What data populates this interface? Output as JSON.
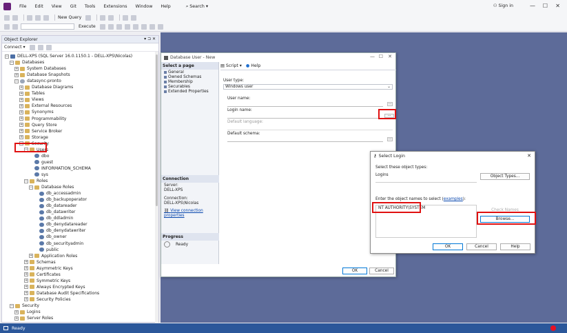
{
  "menubar": {
    "items": [
      "File",
      "Edit",
      "View",
      "Git",
      "Tools",
      "Extensions",
      "Window",
      "Help"
    ],
    "search": "Search",
    "signin": "Sign in"
  },
  "toolbar": {
    "new_query": "New Query",
    "execute": "Execute"
  },
  "object_explorer": {
    "title": "Object Explorer",
    "connect": "Connect",
    "tree": [
      {
        "label": "DELL-XPS (SQL Server 16.0.1150.1 - DELL-XPS\\Nicolas)",
        "indent": 0,
        "toggle": "−",
        "icon": "server"
      },
      {
        "label": "Databases",
        "indent": 1,
        "toggle": "−",
        "icon": "folder"
      },
      {
        "label": "System Databases",
        "indent": 2,
        "toggle": "+",
        "icon": "folder"
      },
      {
        "label": "Database Snapshots",
        "indent": 2,
        "toggle": "+",
        "icon": "folder"
      },
      {
        "label": "datasync-pronto",
        "indent": 2,
        "toggle": "−",
        "icon": "db"
      },
      {
        "label": "Database Diagrams",
        "indent": 3,
        "toggle": "+",
        "icon": "folder"
      },
      {
        "label": "Tables",
        "indent": 3,
        "toggle": "+",
        "icon": "folder"
      },
      {
        "label": "Views",
        "indent": 3,
        "toggle": "+",
        "icon": "folder"
      },
      {
        "label": "External Resources",
        "indent": 3,
        "toggle": "+",
        "icon": "folder"
      },
      {
        "label": "Synonyms",
        "indent": 3,
        "toggle": "+",
        "icon": "folder"
      },
      {
        "label": "Programmability",
        "indent": 3,
        "toggle": "+",
        "icon": "folder"
      },
      {
        "label": "Query Store",
        "indent": 3,
        "toggle": "+",
        "icon": "folder"
      },
      {
        "label": "Service Broker",
        "indent": 3,
        "toggle": "+",
        "icon": "folder"
      },
      {
        "label": "Storage",
        "indent": 3,
        "toggle": "+",
        "icon": "folder"
      },
      {
        "label": "Security",
        "indent": 3,
        "toggle": "−",
        "icon": "folder"
      },
      {
        "label": "Users",
        "indent": 4,
        "toggle": "−",
        "icon": "folder"
      },
      {
        "label": "dbo",
        "indent": 5,
        "toggle": "",
        "icon": "user"
      },
      {
        "label": "guest",
        "indent": 5,
        "toggle": "",
        "icon": "user"
      },
      {
        "label": "INFORMATION_SCHEMA",
        "indent": 5,
        "toggle": "",
        "icon": "user"
      },
      {
        "label": "sys",
        "indent": 5,
        "toggle": "",
        "icon": "user"
      },
      {
        "label": "Roles",
        "indent": 4,
        "toggle": "−",
        "icon": "folder"
      },
      {
        "label": "Database Roles",
        "indent": 5,
        "toggle": "−",
        "icon": "folder"
      },
      {
        "label": "db_accessadmin",
        "indent": 6,
        "toggle": "",
        "icon": "user"
      },
      {
        "label": "db_backupoperator",
        "indent": 6,
        "toggle": "",
        "icon": "user"
      },
      {
        "label": "db_datareader",
        "indent": 6,
        "toggle": "",
        "icon": "user"
      },
      {
        "label": "db_datawriter",
        "indent": 6,
        "toggle": "",
        "icon": "user"
      },
      {
        "label": "db_ddladmin",
        "indent": 6,
        "toggle": "",
        "icon": "user"
      },
      {
        "label": "db_denydatareader",
        "indent": 6,
        "toggle": "",
        "icon": "user"
      },
      {
        "label": "db_denydatawriter",
        "indent": 6,
        "toggle": "",
        "icon": "user"
      },
      {
        "label": "db_owner",
        "indent": 6,
        "toggle": "",
        "icon": "user"
      },
      {
        "label": "db_securityadmin",
        "indent": 6,
        "toggle": "",
        "icon": "user"
      },
      {
        "label": "public",
        "indent": 6,
        "toggle": "",
        "icon": "user"
      },
      {
        "label": "Application Roles",
        "indent": 5,
        "toggle": "+",
        "icon": "folder"
      },
      {
        "label": "Schemas",
        "indent": 4,
        "toggle": "+",
        "icon": "folder"
      },
      {
        "label": "Asymmetric Keys",
        "indent": 4,
        "toggle": "+",
        "icon": "folder"
      },
      {
        "label": "Certificates",
        "indent": 4,
        "toggle": "+",
        "icon": "folder"
      },
      {
        "label": "Symmetric Keys",
        "indent": 4,
        "toggle": "+",
        "icon": "folder"
      },
      {
        "label": "Always Encrypted Keys",
        "indent": 4,
        "toggle": "+",
        "icon": "folder"
      },
      {
        "label": "Database Audit Specifications",
        "indent": 4,
        "toggle": "+",
        "icon": "folder"
      },
      {
        "label": "Security Policies",
        "indent": 4,
        "toggle": "+",
        "icon": "folder"
      },
      {
        "label": "Security",
        "indent": 1,
        "toggle": "−",
        "icon": "folder"
      },
      {
        "label": "Logins",
        "indent": 2,
        "toggle": "+",
        "icon": "folder"
      },
      {
        "label": "Server Roles",
        "indent": 2,
        "toggle": "+",
        "icon": "folder"
      }
    ]
  },
  "db_user_dialog": {
    "title": "Database User - New",
    "select_page": "Select a page",
    "pages": [
      "General",
      "Owned Schemas",
      "Membership",
      "Securables",
      "Extended Properties"
    ],
    "connection_header": "Connection",
    "server_label": "Server:",
    "server_value": "DELL-XPS",
    "connection_label": "Connection:",
    "connection_value": "DELL-XPS\\Nicolas",
    "view_connection": "View connection properties",
    "progress_header": "Progress",
    "progress_status": "Ready",
    "script": "Script",
    "help": "Help",
    "user_type_label": "User type:",
    "user_type_value": "Windows user",
    "user_name_label": "User name:",
    "login_name_label": "Login name:",
    "default_language_label": "Default language:",
    "default_schema_label": "Default schema:",
    "ok": "OK",
    "cancel": "Cancel"
  },
  "select_login_dialog": {
    "title": "Select Login",
    "object_types_label": "Select these object types:",
    "object_types_value": "Logins",
    "object_types_button": "Object Types...",
    "enter_names_label": "Enter the object names to select",
    "examples_link": "examples",
    "object_name_value": "NT AUTHORITY\\SYSTEM",
    "check_names": "Check Names",
    "browse": "Browse...",
    "ok": "OK",
    "cancel": "Cancel",
    "help": "Help"
  },
  "status": {
    "text": "Ready"
  },
  "colors": {
    "status_bar": "#2b579a",
    "highlight_red": "#e01010",
    "main_bg": "#5d6b99"
  }
}
